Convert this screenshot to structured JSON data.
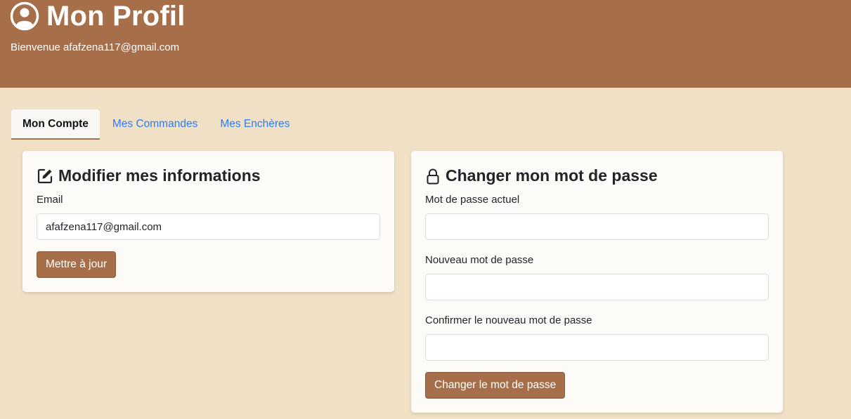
{
  "header": {
    "title": "Mon Profil",
    "icon": "user-circle-icon",
    "welcome": "Bienvenue afafzena117@gmail.com"
  },
  "tabs": [
    {
      "label": "Mon Compte",
      "active": true
    },
    {
      "label": "Mes Commandes",
      "active": false
    },
    {
      "label": "Mes Enchères",
      "active": false
    }
  ],
  "info_card": {
    "icon": "edit-icon",
    "title": "Modifier mes informations",
    "email_label": "Email",
    "email_value": "afafzena117@gmail.com",
    "submit_label": "Mettre à jour"
  },
  "password_card": {
    "icon": "lock-icon",
    "title": "Changer mon mot de passe",
    "current_label": "Mot de passe actuel",
    "current_value": "",
    "new_label": "Nouveau mot de passe",
    "new_value": "",
    "confirm_label": "Confirmer le nouveau mot de passe",
    "confirm_value": "",
    "submit_label": "Changer le mot de passe"
  },
  "colors": {
    "brand": "#a66e49",
    "background": "#f0e1c6",
    "link": "#2e7bf4",
    "card": "#fcfbf8"
  }
}
